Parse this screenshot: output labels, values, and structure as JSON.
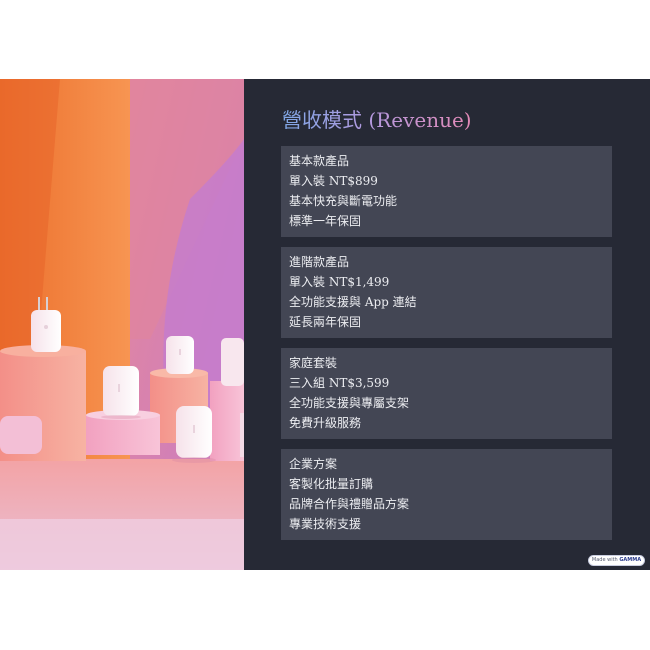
{
  "slide": {
    "title": "營收模式 (Revenue)",
    "cards": [
      {
        "lines": [
          "基本款產品",
          "單入裝 NT$899",
          "基本快充與斷電功能",
          "標準一年保固"
        ]
      },
      {
        "lines": [
          "進階款產品",
          "單入裝 NT$1,499",
          "全功能支援與 App 連結",
          "延長兩年保固"
        ]
      },
      {
        "lines": [
          "家庭套裝",
          "三入組 NT$3,599",
          "全功能支援與專屬支架",
          "免費升級服務"
        ]
      },
      {
        "lines": [
          "企業方案",
          "客製化批量訂購",
          "品牌合作與禮贈品方案",
          "專業技術支援"
        ]
      }
    ]
  },
  "badge": {
    "prefix": "Made with",
    "brand": "GAMMA"
  },
  "colors": {
    "content_background": "#262935",
    "card_background": "#434654",
    "card_text": "#ecedf1",
    "title_gradient_start": "#7fa7e6",
    "title_gradient_end": "#e389b6"
  },
  "icons": {
    "illustration": "charger-products-illustration"
  }
}
